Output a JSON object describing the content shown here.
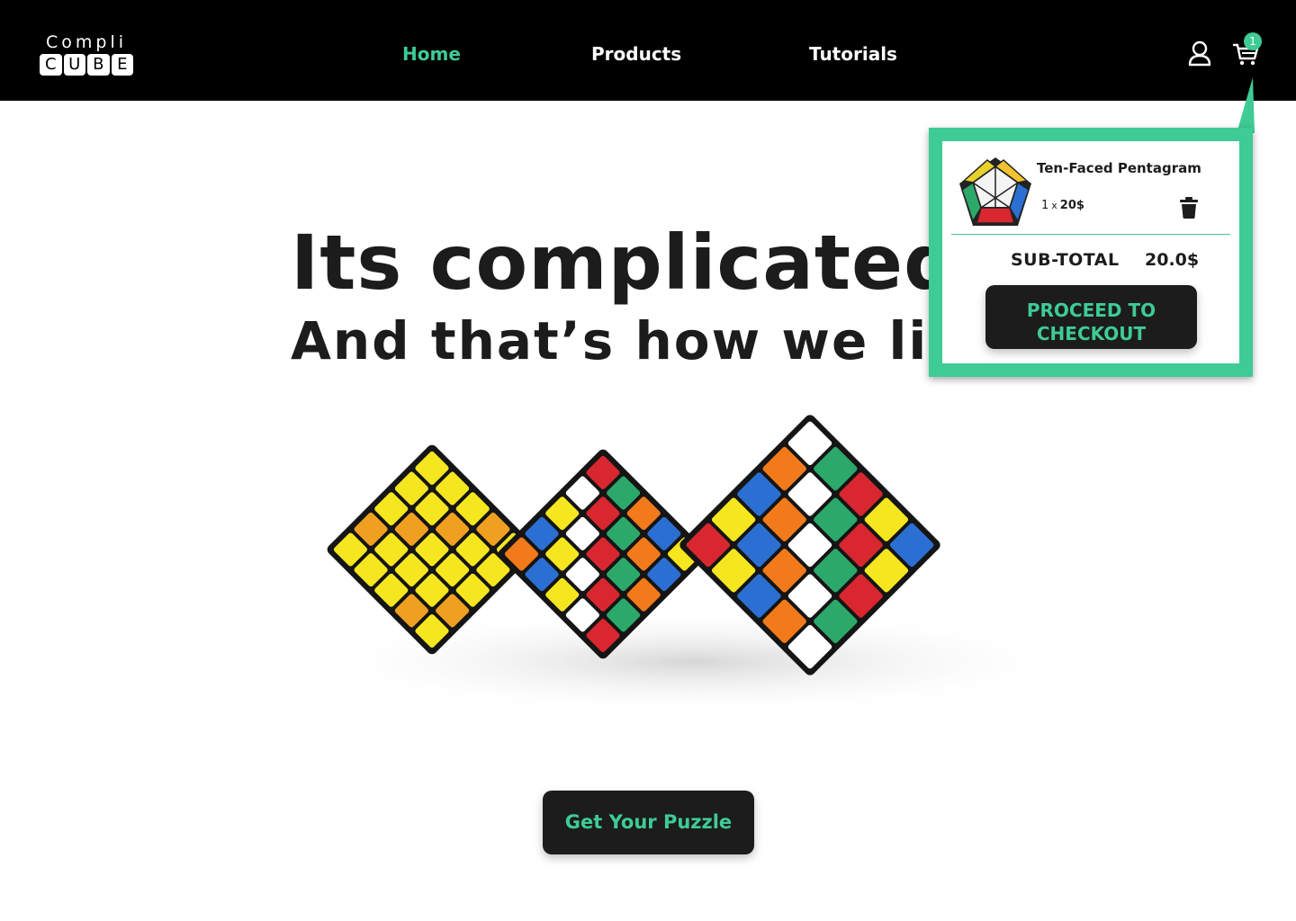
{
  "brand": {
    "top": "Compli",
    "letters": [
      "C",
      "U",
      "B",
      "E"
    ]
  },
  "nav": {
    "items": [
      {
        "label": "Home",
        "active": true
      },
      {
        "label": "Products",
        "active": false
      },
      {
        "label": "Tutorials",
        "active": false
      }
    ]
  },
  "header": {
    "user_icon": "user-icon",
    "cart_icon": "cart-icon",
    "cart_count": "1"
  },
  "hero": {
    "title": "Its complicated..",
    "subtitle": "And that’s how we like it",
    "image": "rubiks-cubes-photo",
    "cta_label": "Get Your Puzzle"
  },
  "cart": {
    "items": [
      {
        "name": "Ten-Faced Pentagram",
        "qty": "1",
        "times": "x",
        "price": "20$",
        "thumb": "megaminx-image"
      }
    ],
    "subtotal_label": "SUB-TOTAL",
    "subtotal_value": "20.0$",
    "checkout_label": "PROCEED TO CHECKOUT"
  },
  "colors": {
    "accent": "#3ecb95",
    "dark": "#1c1c1c",
    "header_bg": "#000000"
  }
}
